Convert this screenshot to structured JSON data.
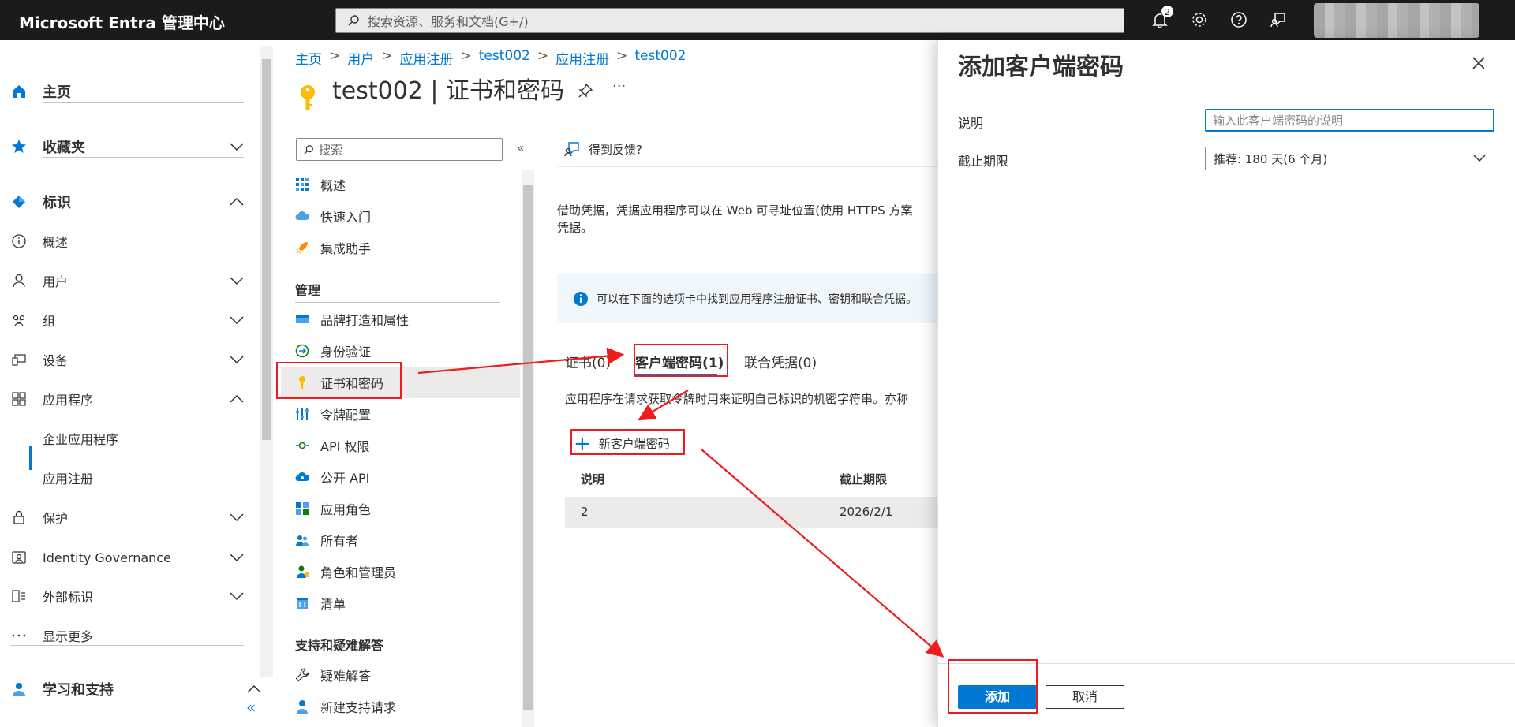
{
  "topbar": {
    "brand": "Microsoft Entra 管理中心",
    "search_placeholder": "搜索资源、服务和文档(G+/)",
    "notification_count": "2"
  },
  "leftnav": {
    "home": "主页",
    "favorites": "收藏夹",
    "identity": "标识",
    "overview": "概述",
    "users": "用户",
    "groups": "组",
    "devices": "设备",
    "applications": "应用程序",
    "enterprise_apps": "企业应用程序",
    "app_registrations": "应用注册",
    "protection": "保护",
    "identity_governance": "Identity Governance",
    "external_identities": "外部标识",
    "show_more": "显示更多",
    "learn_support": "学习和支持",
    "collapse": "«"
  },
  "breadcrumb": [
    "主页",
    "用户",
    "应用注册",
    "test002",
    "应用注册",
    "test002"
  ],
  "page_title": "test002 | 证书和密码",
  "more_label": "···",
  "resource_menu": {
    "search_placeholder": "搜索",
    "collapse": "«",
    "items_top": [
      "概述",
      "快速入门",
      "集成助手"
    ],
    "manage_heading": "管理",
    "manage_items": [
      "品牌打造和属性",
      "身份验证",
      "证书和密码",
      "令牌配置",
      "API 权限",
      "公开 API",
      "应用角色",
      "所有者",
      "角色和管理员",
      "清单"
    ],
    "support_heading": "支持和疑难解答",
    "support_items": [
      "疑难解答",
      "新建支持请求"
    ]
  },
  "content": {
    "feedback": "得到反馈?",
    "description_line1": "借助凭据，凭据应用程序可以在 Web 可寻址位置(使用 HTTPS 方案",
    "description_line2": "凭据。",
    "info": "可以在下面的选项卡中找到应用程序注册证书、密钥和联合凭据。",
    "tabs": [
      "证书(0)",
      "客户端密码(1)",
      "联合凭据(0)"
    ],
    "secret_desc": "应用程序在请求获取令牌时用来证明自己标识的机密字符串。亦称",
    "new_secret": "新客户端密码",
    "table": {
      "headers": [
        "说明",
        "截止期限"
      ],
      "rows": [
        [
          "2",
          "2026/2/1"
        ]
      ]
    }
  },
  "panel": {
    "title": "添加客户端密码",
    "desc_label": "说明",
    "desc_placeholder": "输入此客户端密码的说明",
    "expiry_label": "截止期限",
    "expiry_value": "推荐: 180 天(6 个月)",
    "add": "添加",
    "cancel": "取消"
  },
  "colors": {
    "accent": "#0078d4",
    "annotation": "#ee1c1c",
    "topbar": "#1b1b1b"
  }
}
